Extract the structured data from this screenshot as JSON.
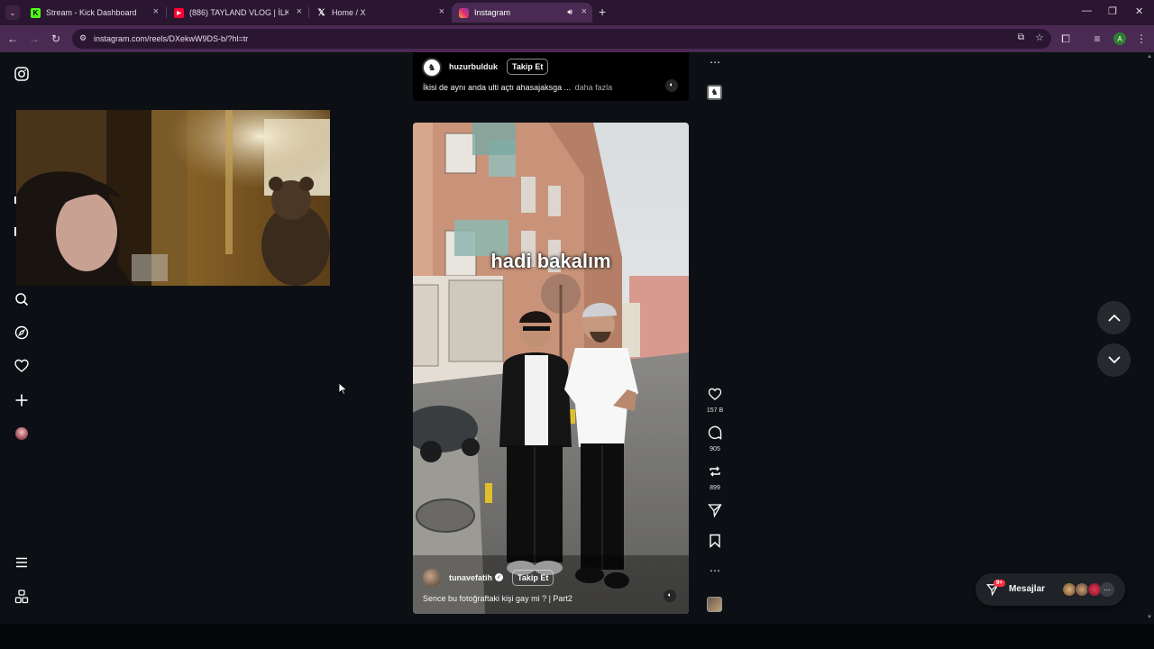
{
  "browser": {
    "tabs": [
      {
        "title": "Stream - Kick Dashboard",
        "favicon": "kick-icon"
      },
      {
        "title": "(886) TAYLAND VLOG | İLK GÜN",
        "favicon": "youtube-icon"
      },
      {
        "title": "Home / X",
        "favicon": "x-icon"
      },
      {
        "title": "Instagram",
        "favicon": "instagram-icon",
        "active": true
      }
    ],
    "url": "instagram.com/reels/DXekwW9DS-b/?hl=tr",
    "profile_initial": "A",
    "colors": {
      "tab_strip": "#2a1630",
      "toolbar": "#4a2a52",
      "omnibox": "#2a1630"
    }
  },
  "top_post": {
    "username": "huzurbulduk",
    "follow_label": "Takip Et",
    "caption": "İkisi de aynı anda ulti açtı ahasajaksga ...",
    "more_label": "daha fazla"
  },
  "reel": {
    "overlay_text": "hadi bakalım",
    "username": "tunavefatih",
    "verified": true,
    "follow_label": "Takip Et",
    "caption": "Sence bu fotoğraftaki kişi gay mi ? | Part2",
    "likes": "157 B",
    "comments": "905",
    "reposts": "899"
  },
  "messages": {
    "label": "Mesajlar",
    "badge": "9+"
  },
  "icons": [
    "instagram-logo-icon",
    "search-icon",
    "explore-icon",
    "heart-icon",
    "plus-icon",
    "menu-icon",
    "apps-icon",
    "comment-icon",
    "repost-icon",
    "share-icon",
    "bookmark-icon",
    "more-icon",
    "mute-icon",
    "chevron-up-icon",
    "chevron-down-icon"
  ]
}
